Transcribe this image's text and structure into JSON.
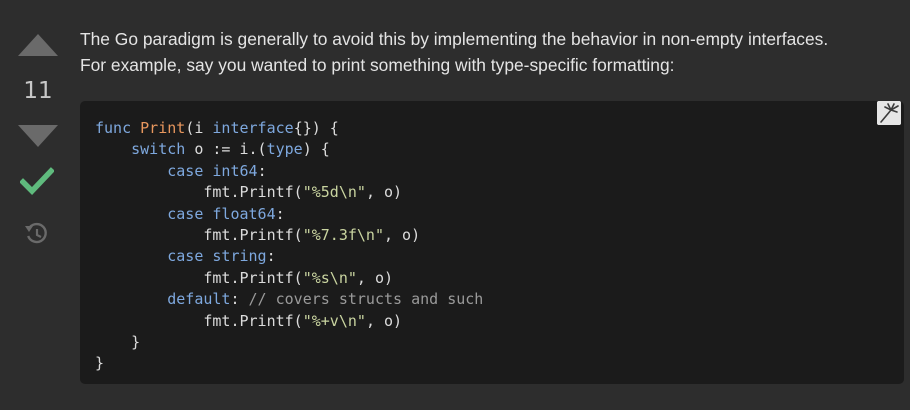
{
  "vote": {
    "score": "11",
    "upvote_icon": "triangle-up-icon",
    "downvote_icon": "triangle-down-icon",
    "accepted_icon": "checkmark-icon",
    "history_icon": "history-icon",
    "accent_color": "#5fba7d",
    "arrow_color": "#6a6a6a"
  },
  "post": {
    "lines": [
      "The Go paradigm is generally to avoid this by implementing the behavior in non-empty interfaces.",
      "For example, say you wanted to print something with type-specific formatting:"
    ]
  },
  "code": {
    "language": "go",
    "copy_icon": "copy-code-icon",
    "lines": [
      [
        {
          "t": "kw",
          "v": "func "
        },
        {
          "t": "fn",
          "v": "Print"
        },
        {
          "t": "pl",
          "v": "(i "
        },
        {
          "t": "kw",
          "v": "interface"
        },
        {
          "t": "pl",
          "v": "{}) {"
        }
      ],
      [
        {
          "t": "pl",
          "v": "    "
        },
        {
          "t": "kw",
          "v": "switch"
        },
        {
          "t": "pl",
          "v": " o := i.("
        },
        {
          "t": "kw",
          "v": "type"
        },
        {
          "t": "pl",
          "v": ") {"
        }
      ],
      [
        {
          "t": "pl",
          "v": "        "
        },
        {
          "t": "kw",
          "v": "case"
        },
        {
          "t": "pl",
          "v": " "
        },
        {
          "t": "ty",
          "v": "int64"
        },
        {
          "t": "pl",
          "v": ":"
        }
      ],
      [
        {
          "t": "pl",
          "v": "            fmt.Printf("
        },
        {
          "t": "str",
          "v": "\"%5d\\n\""
        },
        {
          "t": "pl",
          "v": ", o)"
        }
      ],
      [
        {
          "t": "pl",
          "v": "        "
        },
        {
          "t": "kw",
          "v": "case"
        },
        {
          "t": "pl",
          "v": " "
        },
        {
          "t": "ty",
          "v": "float64"
        },
        {
          "t": "pl",
          "v": ":"
        }
      ],
      [
        {
          "t": "pl",
          "v": "            fmt.Printf("
        },
        {
          "t": "str",
          "v": "\"%7.3f\\n\""
        },
        {
          "t": "pl",
          "v": ", o)"
        }
      ],
      [
        {
          "t": "pl",
          "v": "        "
        },
        {
          "t": "kw",
          "v": "case"
        },
        {
          "t": "pl",
          "v": " "
        },
        {
          "t": "ty",
          "v": "string"
        },
        {
          "t": "pl",
          "v": ":"
        }
      ],
      [
        {
          "t": "pl",
          "v": "            fmt.Printf("
        },
        {
          "t": "str",
          "v": "\"%s\\n\""
        },
        {
          "t": "pl",
          "v": ", o)"
        }
      ],
      [
        {
          "t": "pl",
          "v": "        "
        },
        {
          "t": "kw",
          "v": "default"
        },
        {
          "t": "pl",
          "v": ": "
        },
        {
          "t": "cm",
          "v": "// covers structs and such"
        }
      ],
      [
        {
          "t": "pl",
          "v": "            fmt.Printf("
        },
        {
          "t": "str",
          "v": "\"%+v\\n\""
        },
        {
          "t": "pl",
          "v": ", o)"
        }
      ],
      [
        {
          "t": "pl",
          "v": "    }"
        }
      ],
      [
        {
          "t": "pl",
          "v": "}"
        }
      ]
    ]
  }
}
